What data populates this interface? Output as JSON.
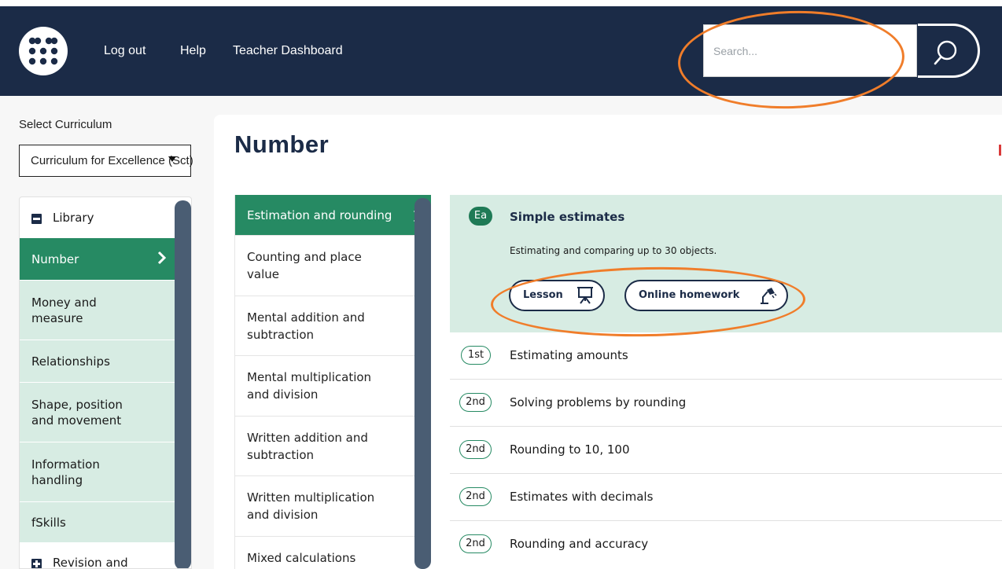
{
  "header": {
    "logout_label": "Log out",
    "help_label": "Help",
    "dashboard_label": "Teacher Dashboard",
    "search_placeholder": "Search..."
  },
  "sidebar": {
    "select_label": "Select Curriculum",
    "curriculum_value": "Curriculum for Excellence (Sct)",
    "library_label": "Library",
    "items": [
      {
        "label": "Number"
      },
      {
        "label": "Money and measure"
      },
      {
        "label": "Relationships"
      },
      {
        "label": "Shape, position and movement"
      },
      {
        "label": "Information handling"
      },
      {
        "label": "fSkills"
      }
    ],
    "revision_label": "Revision and"
  },
  "main": {
    "title": "Number",
    "topics": [
      {
        "label": "Estimation and rounding"
      },
      {
        "label": "Counting and place value"
      },
      {
        "label": "Mental addition and subtraction"
      },
      {
        "label": "Mental multiplication and division"
      },
      {
        "label": "Written addition and subtraction"
      },
      {
        "label": "Written multiplication and division"
      },
      {
        "label": "Mixed calculations"
      }
    ],
    "featured": {
      "level": "Ea",
      "title": "Simple estimates",
      "description": "Estimating and comparing up to 30 objects.",
      "lesson_label": "Lesson",
      "homework_label": "Online homework"
    },
    "lessons": [
      {
        "level": "1st",
        "title": "Estimating amounts"
      },
      {
        "level": "2nd",
        "title": "Solving problems by rounding"
      },
      {
        "level": "2nd",
        "title": "Rounding to 10, 100"
      },
      {
        "level": "2nd",
        "title": "Estimates with decimals"
      },
      {
        "level": "2nd",
        "title": "Rounding and accuracy"
      }
    ]
  },
  "colors": {
    "header_bg": "#1b2b47",
    "accent_green": "#268a63",
    "light_green": "#d7ece3",
    "highlight_orange": "#f07d2a"
  }
}
